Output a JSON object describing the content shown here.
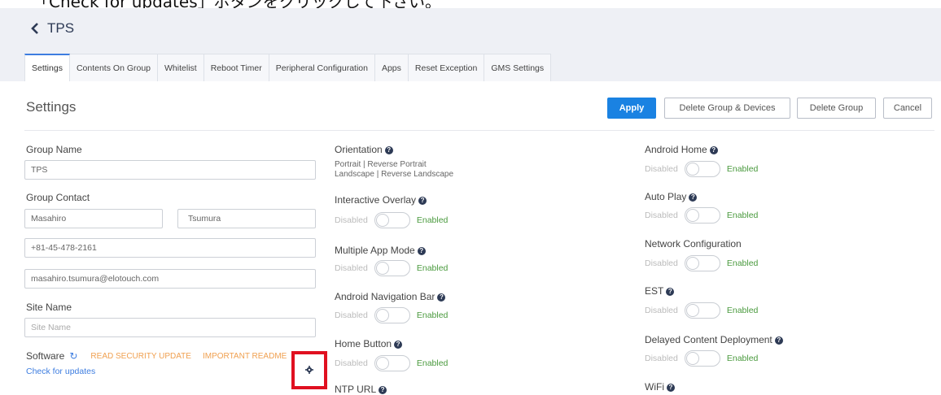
{
  "caption": "「Check for updates」ボタンをクリックして下さい。",
  "header": {
    "back_label": "TPS"
  },
  "tabs": [
    "Settings",
    "Contents On Group",
    "Whitelist",
    "Reboot Timer",
    "Peripheral Configuration",
    "Apps",
    "Reset Exception",
    "GMS Settings"
  ],
  "active_tab": "Settings",
  "settings": {
    "title": "Settings",
    "buttons": {
      "apply": "Apply",
      "delete_group_devices": "Delete Group & Devices",
      "delete_group": "Delete Group",
      "cancel": "Cancel"
    }
  },
  "col1": {
    "group_name_label": "Group Name",
    "group_name_value": "TPS",
    "group_contact_label": "Group Contact",
    "first_name": "Masahiro",
    "last_name": "Tsumura",
    "phone": "+81-45-478-2161",
    "email": "masahiro.tsumura@elotouch.com",
    "site_name_label": "Site Name",
    "site_name_placeholder": "Site Name",
    "software_label": "Software",
    "read_security": "READ SECURITY UPDATE",
    "important_readme": "IMPORTANT README",
    "check_updates": "Check for updates"
  },
  "col2": {
    "orientation_label": "Orientation",
    "orientation_line1": "Portrait | Reverse Portrait",
    "orientation_line2": "Landscape | Reverse Landscape",
    "interactive_overlay": "Interactive Overlay",
    "multiple_app_mode": "Multiple App Mode",
    "android_nav_bar": "Android Navigation Bar",
    "home_button": "Home Button",
    "ntp_url": "NTP URL"
  },
  "col3": {
    "android_home": "Android Home",
    "auto_play": "Auto Play",
    "network_config": "Network Configuration",
    "est": "EST",
    "delayed_content": "Delayed Content Deployment",
    "wifi": "WiFi"
  },
  "toggle": {
    "off": "Disabled",
    "on": "Enabled"
  }
}
